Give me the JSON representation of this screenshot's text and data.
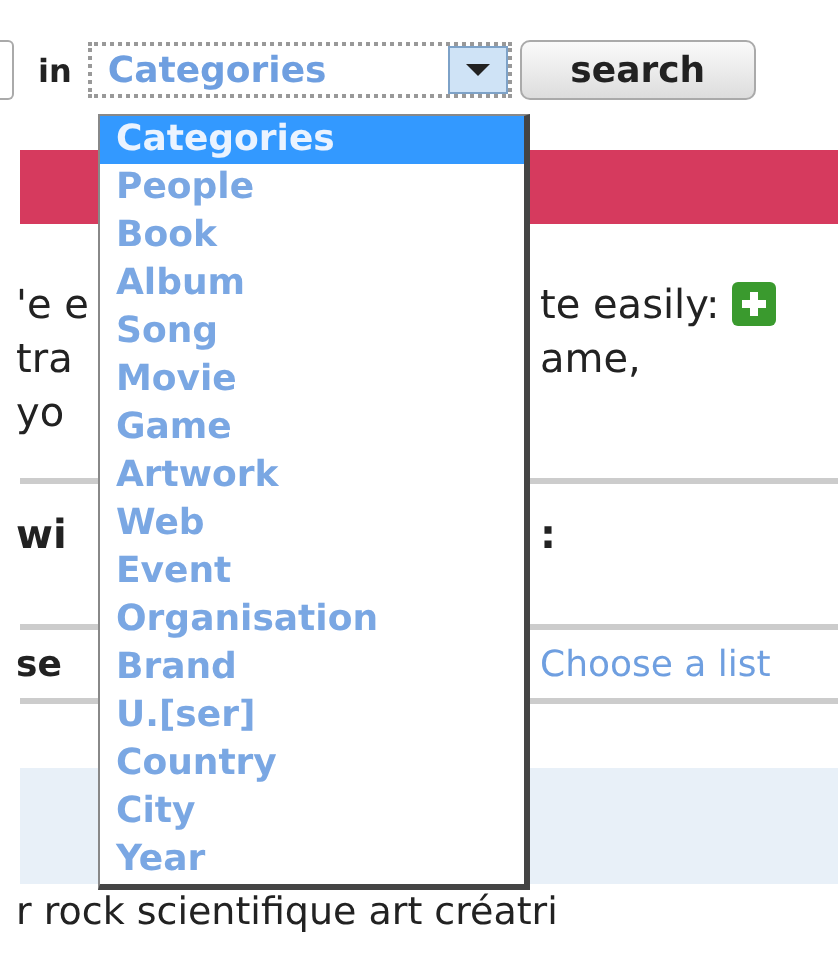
{
  "search": {
    "in_label": "in",
    "select_value": "Categories",
    "button": "search"
  },
  "dropdown": {
    "options": [
      {
        "label": "Categories",
        "selected": true
      },
      {
        "label": "People",
        "selected": false
      },
      {
        "label": "Book",
        "selected": false
      },
      {
        "label": "Album",
        "selected": false
      },
      {
        "label": "Song",
        "selected": false
      },
      {
        "label": "Movie",
        "selected": false
      },
      {
        "label": "Game",
        "selected": false
      },
      {
        "label": "Artwork",
        "selected": false
      },
      {
        "label": "Web",
        "selected": false
      },
      {
        "label": "Event",
        "selected": false
      },
      {
        "label": "Organisation",
        "selected": false
      },
      {
        "label": "Brand",
        "selected": false
      },
      {
        "label": "U.[ser]",
        "selected": false
      },
      {
        "label": "Country",
        "selected": false
      },
      {
        "label": "City",
        "selected": false
      },
      {
        "label": "Year",
        "selected": false
      }
    ]
  },
  "lines": [
    {
      "kind": "text",
      "left": "'e e",
      "right": "te easily:",
      "add_icon": true
    },
    {
      "kind": "text",
      "left": "tra",
      "right": "ame,"
    },
    {
      "kind": "text",
      "left": "yo"
    },
    {
      "kind": "heading",
      "left": "wi",
      "right": ":"
    },
    {
      "kind": "listbar",
      "left": "se",
      "link": "Choose a list"
    }
  ],
  "tags_line": "r rock scientifique art créatri"
}
